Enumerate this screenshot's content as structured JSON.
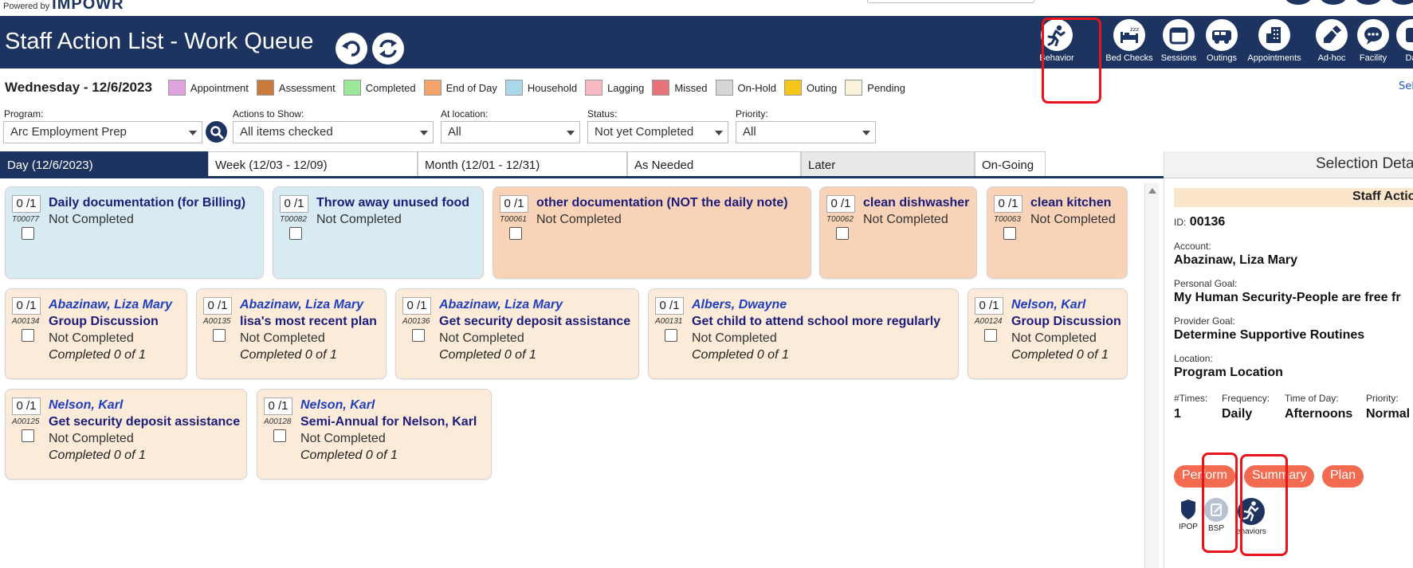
{
  "brand": {
    "powered_by": "Powered by",
    "name": "IMPOWR"
  },
  "header": {
    "title": "Staff Action List - Work Queue"
  },
  "toolbar": [
    {
      "label": "Behavior",
      "icon": "running-person-icon"
    },
    {
      "label": "Bed Checks",
      "icon": "bed-icon"
    },
    {
      "label": "Sessions",
      "icon": "calendar-icon"
    },
    {
      "label": "Outings",
      "icon": "van-icon"
    },
    {
      "label": "Appointments",
      "icon": "building-icon"
    },
    {
      "label": "Ad-hoc",
      "icon": "edit-hand-icon"
    },
    {
      "label": "Facility",
      "icon": "chat-icon"
    },
    {
      "label": "Dat",
      "icon": "data-icon"
    }
  ],
  "date_label": "Wednesday - 12/6/2023",
  "legend": [
    {
      "label": "Appointment",
      "color": "#dea3dc"
    },
    {
      "label": "Assessment",
      "color": "#c97a3f"
    },
    {
      "label": "Completed",
      "color": "#9be89b"
    },
    {
      "label": "End of Day",
      "color": "#f5a36d"
    },
    {
      "label": "Household",
      "color": "#a9d8ea"
    },
    {
      "label": "Lagging",
      "color": "#f8b9c3"
    },
    {
      "label": "Missed",
      "color": "#e8727a"
    },
    {
      "label": "On-Hold",
      "color": "#d6d6d6"
    },
    {
      "label": "Outing",
      "color": "#f5c518"
    },
    {
      "label": "Pending",
      "color": "#faf3dc"
    }
  ],
  "select_link": "Sel",
  "filters": {
    "program": {
      "label": "Program:",
      "value": "Arc Employment Prep"
    },
    "actions": {
      "label": "Actions to Show:",
      "value": "All items checked"
    },
    "location": {
      "label": "At location:",
      "value": "All"
    },
    "status": {
      "label": "Status:",
      "value": "Not yet Completed"
    },
    "priority": {
      "label": "Priority:",
      "value": "All"
    }
  },
  "tabs": [
    "Day (12/6/2023)",
    "Week (12/03 - 12/09)",
    "Month (12/01 - 12/31)",
    "As Needed",
    "Later",
    "On-Going"
  ],
  "cards": [
    {
      "count": "0 /1",
      "code": "T00077",
      "title": "Daily documentation (for Billing)",
      "status": "Not Completed"
    },
    {
      "count": "0 /1",
      "code": "T00082",
      "title": "Throw away unused food",
      "status": "Not Completed"
    },
    {
      "count": "0 /1",
      "code": "T00061",
      "title": "other documentation (NOT the daily note)",
      "status": "Not Completed"
    },
    {
      "count": "0 /1",
      "code": "T00062",
      "title": "clean dishwasher",
      "status": "Not Completed"
    },
    {
      "count": "0 /1",
      "code": "T00063",
      "title": "clean kitchen",
      "status": "Not Completed"
    },
    {
      "count": "0 /1",
      "code": "A00134",
      "name": "Abazinaw, Liza Mary",
      "title": "Group Discussion",
      "status": "Not Completed",
      "done": "Completed 0 of 1"
    },
    {
      "count": "0 /1",
      "code": "A00135",
      "name": "Abazinaw, Liza Mary",
      "title": "lisa's most recent plan",
      "status": "Not Completed",
      "done": "Completed 0 of 1"
    },
    {
      "count": "0 /1",
      "code": "A00136",
      "name": "Abazinaw, Liza Mary",
      "title": "Get security deposit assistance",
      "status": "Not Completed",
      "done": "Completed 0 of 1"
    },
    {
      "count": "0 /1",
      "code": "A00131",
      "name": "Albers, Dwayne",
      "title": "Get child to attend school more regularly",
      "status": "Not Completed",
      "done": "Completed 0 of 1"
    },
    {
      "count": "0 /1",
      "code": "A00124",
      "name": "Nelson, Karl",
      "title": "Group Discussion",
      "status": "Not Completed",
      "done": "Completed 0 of 1"
    },
    {
      "count": "0 /1",
      "code": "A00125",
      "name": "Nelson, Karl",
      "title": "Get security deposit assistance",
      "status": "Not Completed",
      "done": "Completed 0 of 1"
    },
    {
      "count": "0 /1",
      "code": "A00128",
      "name": "Nelson, Karl",
      "title": "Semi-Annual for Nelson, Karl",
      "status": "Not Completed",
      "done": "Completed 0 of 1"
    }
  ],
  "selection": {
    "header": "Selection Deta",
    "staff_label": "Staff Actio",
    "id_label": "ID:",
    "id_value": "00136",
    "account_label": "Account:",
    "account_value": "Abazinaw, Liza Mary",
    "personal_goal_label": "Personal Goal:",
    "personal_goal_value": "My Human Security-People are free fr",
    "provider_goal_label": "Provider Goal:",
    "provider_goal_value": "Determine Supportive Routines",
    "location_label": "Location:",
    "location_value": "Program Location",
    "times_label": "#Times:",
    "times_value": "1",
    "frequency_label": "Frequency:",
    "frequency_value": "Daily",
    "tod_label": "Time of Day:",
    "tod_value": "Afternoons",
    "priority_label": "Priority:",
    "priority_value": "Normal",
    "buttons": [
      "Perform",
      "Summary",
      "Plan"
    ],
    "icons": [
      "IPOP",
      "BSP",
      "ehaviors"
    ]
  }
}
